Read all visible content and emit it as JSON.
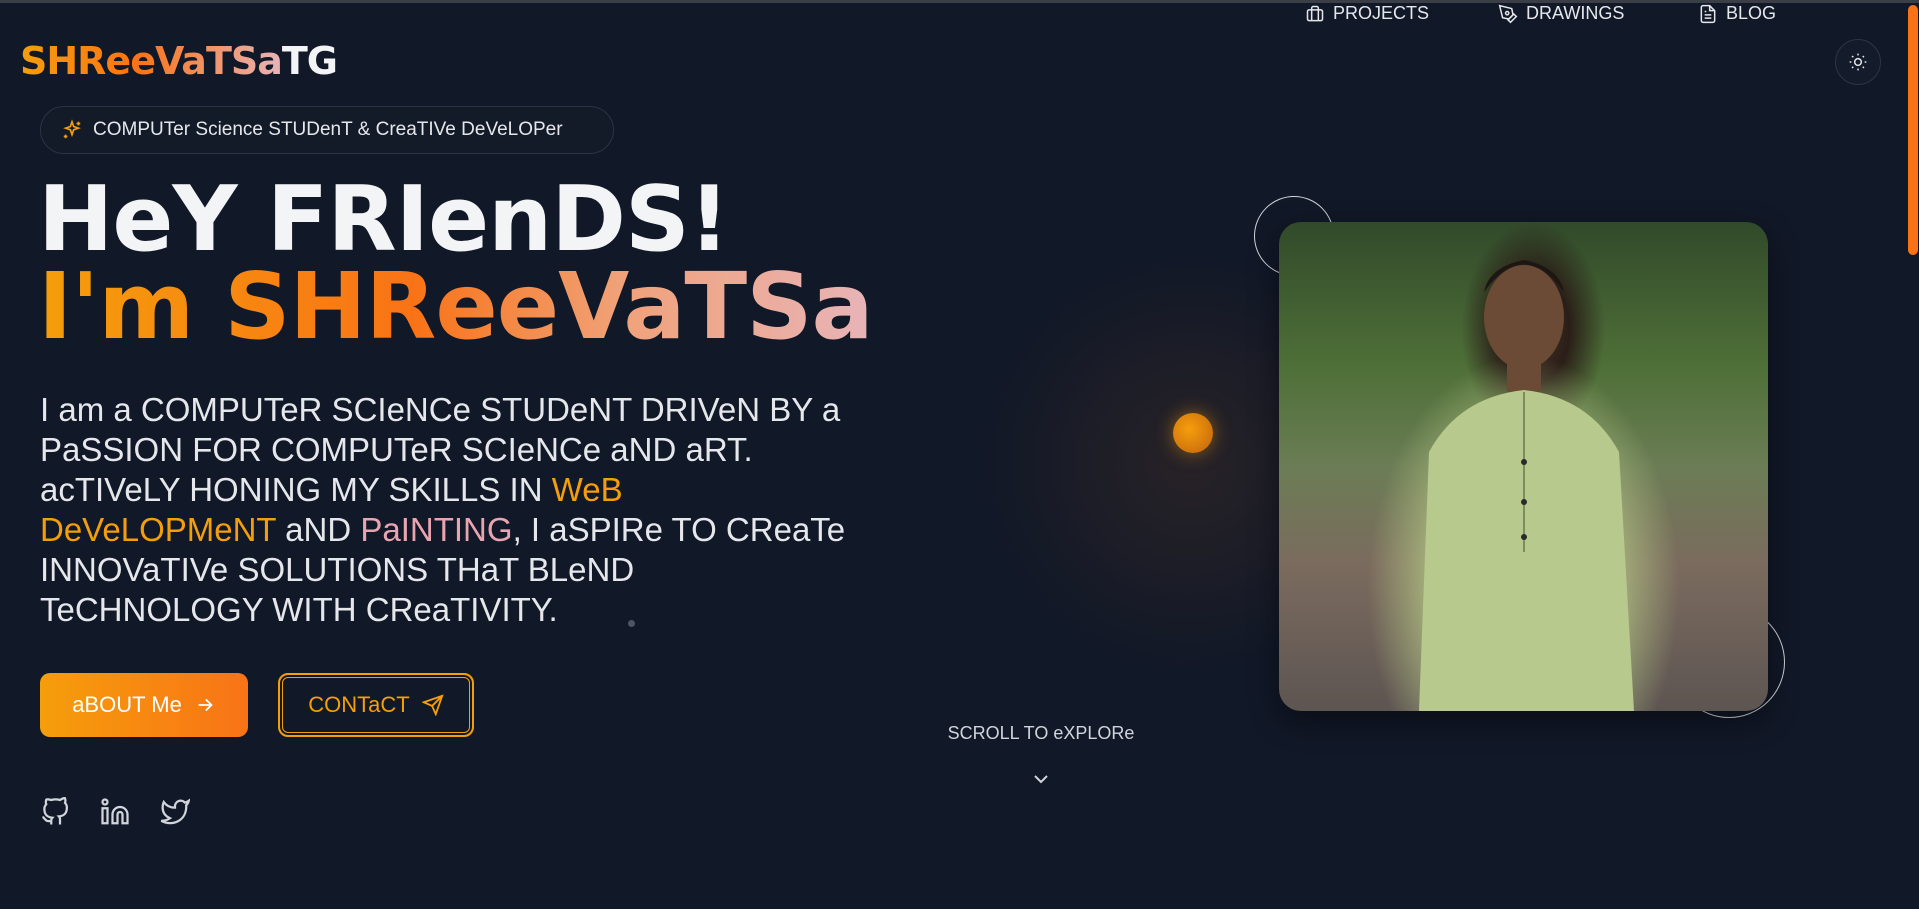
{
  "brand": {
    "name_gradient": "SHReeVaTSa",
    "name_suffix": "TG"
  },
  "nav": {
    "items": [
      {
        "label": "PROJECTS",
        "icon": "briefcase-icon"
      },
      {
        "label": "DRAWINGS",
        "icon": "pen-tool-icon"
      },
      {
        "label": "BLOG",
        "icon": "document-icon"
      }
    ],
    "theme_toggle_icon": "sun-icon"
  },
  "badge": {
    "text": "COMPUTer Science STUDenT & CreaTIVe DeVeLOPer",
    "icon": "sparkles-icon"
  },
  "hero": {
    "greeting": "HeY FRIenDS!",
    "intro": "I'm SHReeVaTSa",
    "desc_1": "I am a COMPUTeR SCIeNCe STUDeNT DRIVeN BY a PaSSION FOR COMPUTeR SCIeNCe aND aRT. acTIVeLY HONING MY SKILLS IN ",
    "desc_hl1": "WeB DeVeLOPMeNT",
    "desc_2": " aND ",
    "desc_hl2": "PaINTING",
    "desc_3": ", I aSPIRe TO CReaTe INNOVaTIVe SOLUTIONS THaT BLeND TeCHNOLOGY WITH CReaTIVITY."
  },
  "buttons": {
    "about_label": "aBOUT Me",
    "contact_label": "CONTaCT"
  },
  "socials": [
    "github-icon",
    "linkedin-icon",
    "twitter-icon"
  ],
  "scroll": {
    "text": "SCROLL TO eXPLORe"
  },
  "colors": {
    "background": "#111827",
    "accent": "#f59e0b",
    "accent_2": "#f97316",
    "pink": "#e8b4b8"
  }
}
